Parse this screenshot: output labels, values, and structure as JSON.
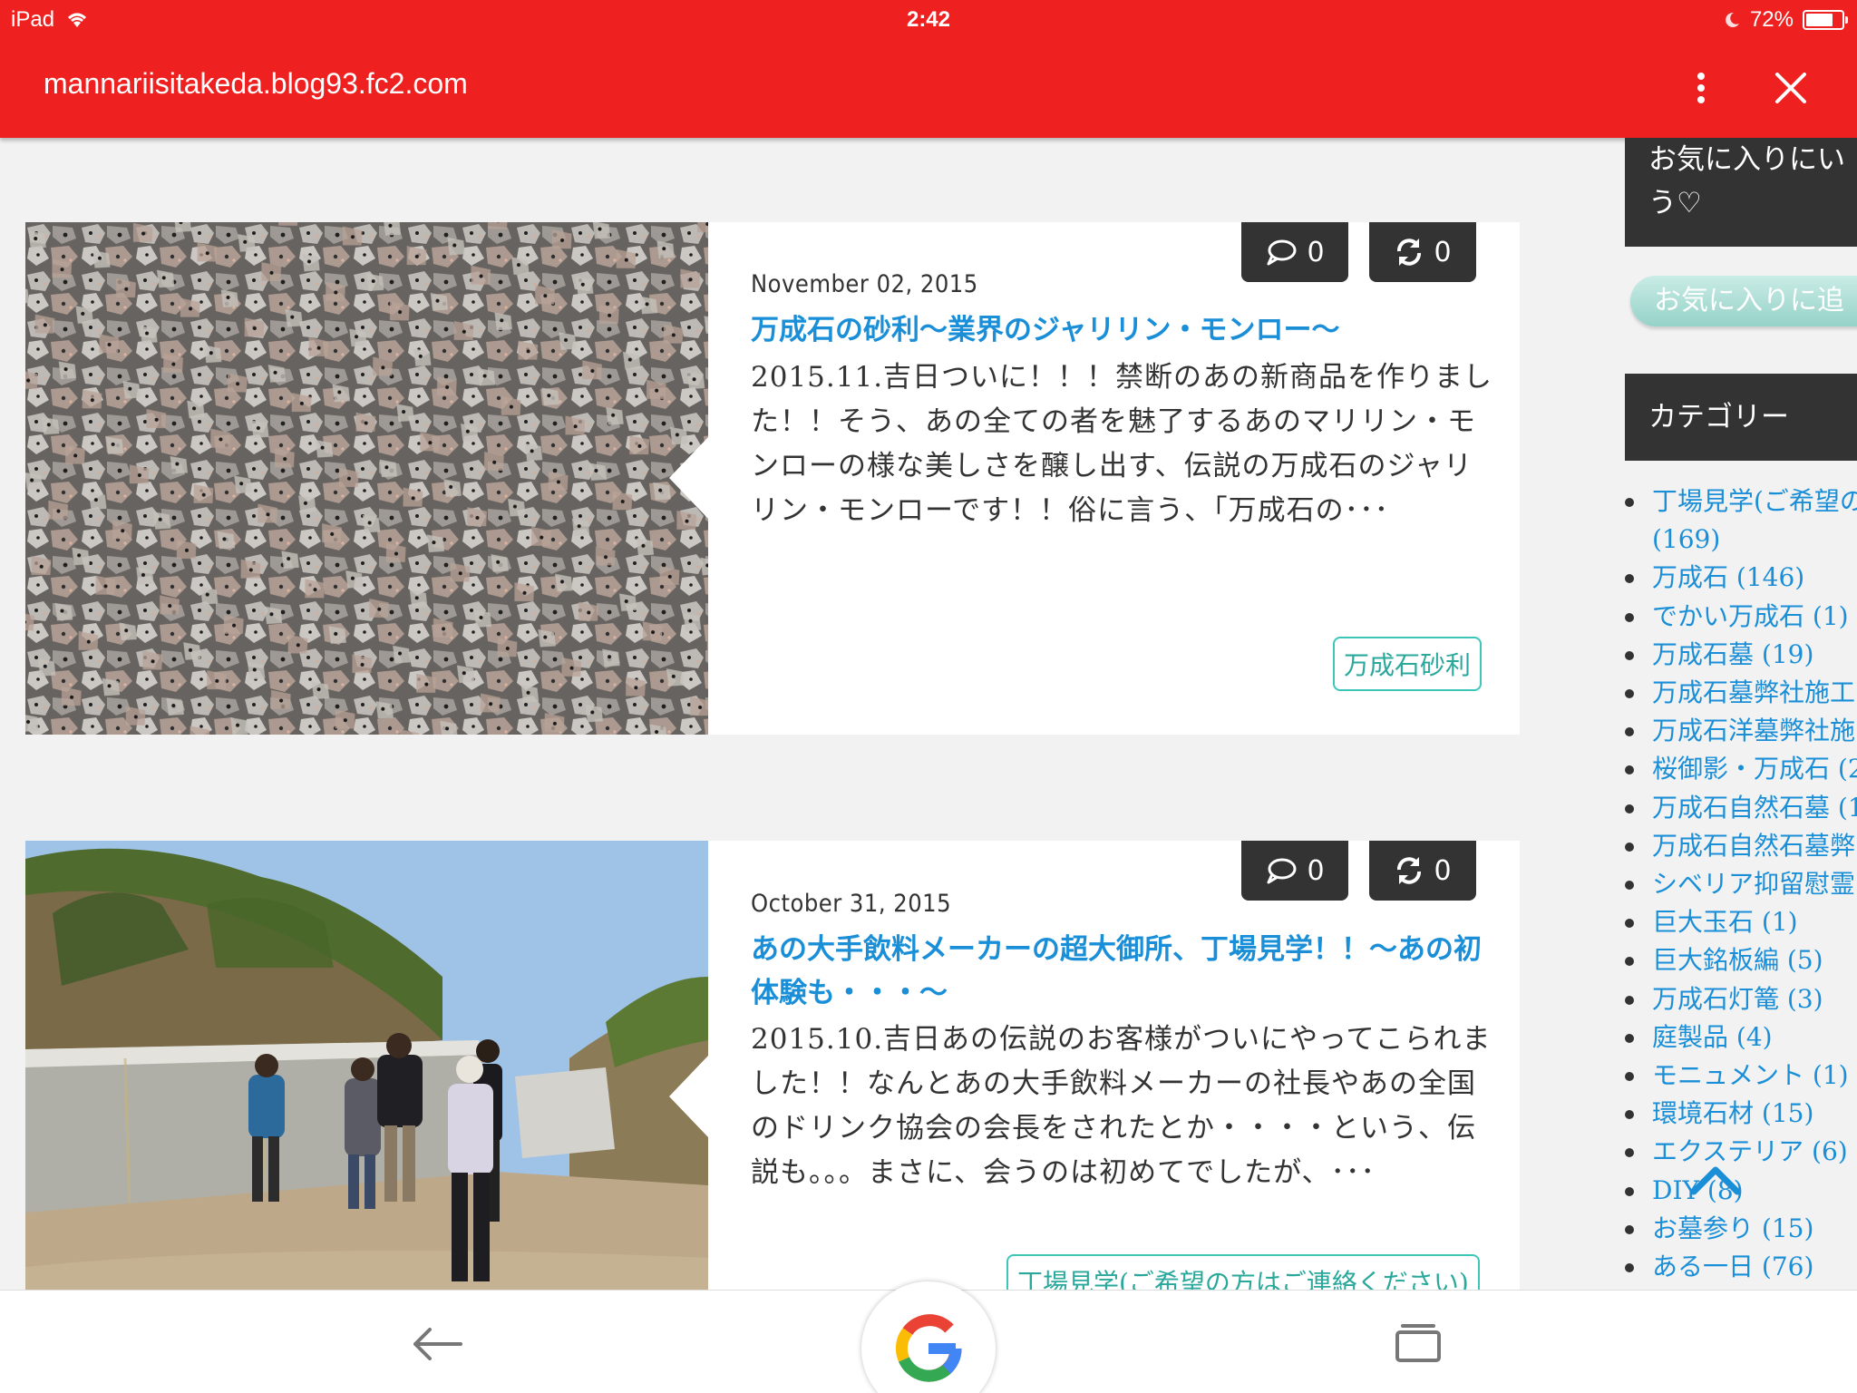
{
  "status": {
    "device": "iPad",
    "time": "2:42",
    "battery": "72%"
  },
  "browser": {
    "url": "mannariisitakeda.blog93.fc2.com"
  },
  "posts": [
    {
      "date": "November 02, 2015",
      "title": "万成石の砂利〜業界のジャリリン・モンロー〜",
      "excerpt": "2015.11.吉日ついに！！！禁断のあの新商品を作りました！！そう、あの全ての者を魅了するあのマリリン・モンローの様な美しさを醸し出す、伝説の万成石のジャリリン・モンローです！！俗に言う、「万成石の･･･",
      "comments": "0",
      "retweets": "0",
      "tag": "万成石砂利"
    },
    {
      "date": "October 31, 2015",
      "title": "あの大手飲料メーカーの超大御所、丁場見学！！〜あの初体験も・・・〜",
      "excerpt": "2015.10.吉日あの伝説のお客様がついにやってこられました！！なんとあの大手飲料メーカーの社長やあの全国のドリンク協会の会長をされたとか・・・・という、伝説も。。。まさに、会うのは初めてでしたが、･･･",
      "comments": "0",
      "retweets": "0",
      "tag": "丁場見学(ご希望の方はご連絡ください)"
    }
  ],
  "sidebar": {
    "fav_text_1": "お気に入りにい",
    "fav_text_2": "う♡",
    "fav_button": "お気に入りに追",
    "category_heading": "カテゴリー",
    "categories": [
      {
        "label": "丁場見学(ご希望の",
        "count": "(169)"
      },
      {
        "label": "万成石 (146)"
      },
      {
        "label": "でかい万成石 (1)"
      },
      {
        "label": "万成石墓 (19)"
      },
      {
        "label": "万成石墓弊社施工"
      },
      {
        "label": "万成石洋墓弊社施"
      },
      {
        "label": "桜御影・万成石 (2"
      },
      {
        "label": "万成石自然石墓 (1"
      },
      {
        "label": "万成石自然石墓弊"
      },
      {
        "label": "シベリア抑留慰霊"
      },
      {
        "label": "巨大玉石 (1)"
      },
      {
        "label": "巨大銘板編 (5)"
      },
      {
        "label": "万成石灯篭 (3)"
      },
      {
        "label": "庭製品 (4)"
      },
      {
        "label": "モニュメント (1)"
      },
      {
        "label": "環境石材 (15)"
      },
      {
        "label": "エクステリア (6)"
      },
      {
        "label": "DIY (8)"
      },
      {
        "label": "お墓参り (15)"
      },
      {
        "label": "ある一日 (76)"
      }
    ]
  },
  "colors": {
    "brand_red": "#ee2020",
    "link_blue": "#1a8fd8",
    "tag_teal": "#3cc7b8",
    "dark_box": "#333333"
  },
  "icons": [
    "wifi-icon",
    "moon-icon",
    "battery-icon",
    "more-vert-icon",
    "close-icon",
    "comment-icon",
    "retweet-icon",
    "scroll-top-icon",
    "back-arrow-icon",
    "google-icon",
    "tabs-icon"
  ]
}
